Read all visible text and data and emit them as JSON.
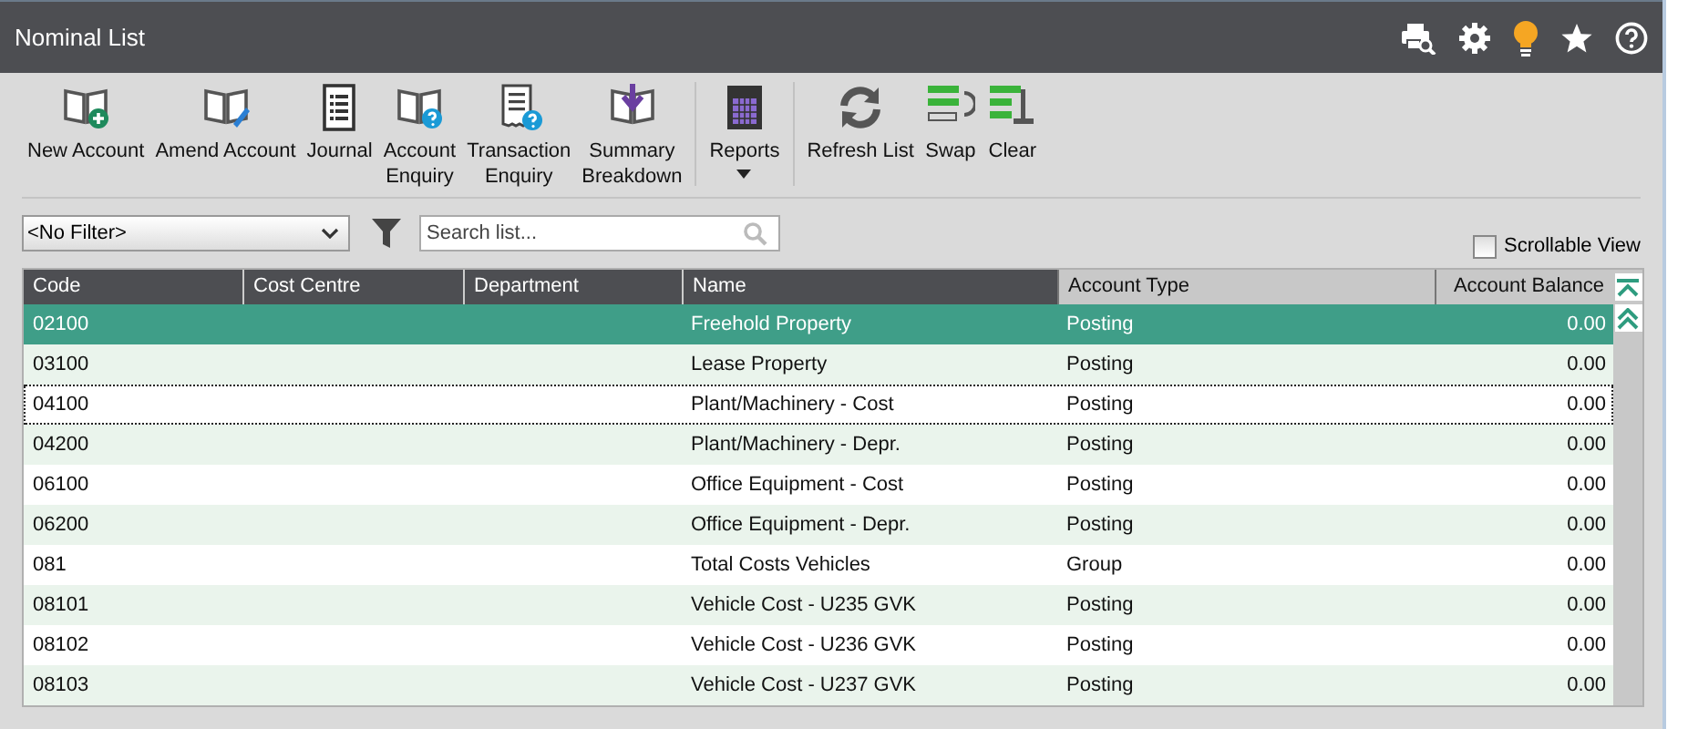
{
  "window": {
    "title": "Nominal List"
  },
  "toolbar": {
    "groups": [
      [
        {
          "label": "New Account",
          "kind": "book-plus"
        },
        {
          "label": "Amend Account",
          "kind": "book-pencil"
        },
        {
          "label": "Journal",
          "kind": "journal"
        },
        {
          "label": "Account\nEnquiry",
          "kind": "book-question"
        },
        {
          "label": "Transaction\nEnquiry",
          "kind": "receipt-question"
        },
        {
          "label": "Summary\nBreakdown",
          "kind": "book-download"
        }
      ],
      [
        {
          "label": "Reports",
          "kind": "reports",
          "dropdown": true
        }
      ],
      [
        {
          "label": "Refresh List",
          "kind": "refresh"
        },
        {
          "label": "Swap",
          "kind": "swap"
        },
        {
          "label": "Clear",
          "kind": "clear"
        }
      ]
    ]
  },
  "filter": {
    "value": "<No Filter>",
    "search_placeholder": "Search list...",
    "scrollable_view": {
      "label": "Scrollable View",
      "checked": false
    }
  },
  "table": {
    "columns": [
      {
        "label": "Code"
      },
      {
        "label": "Cost Centre"
      },
      {
        "label": "Department"
      },
      {
        "label": "Name"
      },
      {
        "label": "Account Type"
      },
      {
        "label": "Account Balance"
      }
    ],
    "rows": [
      {
        "cells": [
          "02100",
          "",
          "",
          "Freehold Property",
          "Posting",
          "0.00"
        ],
        "selected": true,
        "focused": false
      },
      {
        "cells": [
          "03100",
          "",
          "",
          "Lease Property",
          "Posting",
          "0.00"
        ],
        "selected": false,
        "focused": false
      },
      {
        "cells": [
          "04100",
          "",
          "",
          "Plant/Machinery - Cost",
          "Posting",
          "0.00"
        ],
        "selected": false,
        "focused": true
      },
      {
        "cells": [
          "04200",
          "",
          "",
          "Plant/Machinery - Depr.",
          "Posting",
          "0.00"
        ],
        "selected": false,
        "focused": false
      },
      {
        "cells": [
          "06100",
          "",
          "",
          "Office Equipment - Cost",
          "Posting",
          "0.00"
        ],
        "selected": false,
        "focused": false
      },
      {
        "cells": [
          "06200",
          "",
          "",
          "Office Equipment - Depr.",
          "Posting",
          "0.00"
        ],
        "selected": false,
        "focused": false
      },
      {
        "cells": [
          "081",
          "",
          "",
          "Total Costs Vehicles",
          "Group",
          "0.00"
        ],
        "selected": false,
        "focused": false
      },
      {
        "cells": [
          "08101",
          "",
          "",
          "Vehicle Cost - U235 GVK",
          "Posting",
          "0.00"
        ],
        "selected": false,
        "focused": false
      },
      {
        "cells": [
          "08102",
          "",
          "",
          "Vehicle Cost - U236 GVK",
          "Posting",
          "0.00"
        ],
        "selected": false,
        "focused": false
      },
      {
        "cells": [
          "08103",
          "",
          "",
          "Vehicle Cost - U237 GVK",
          "Posting",
          "0.00"
        ],
        "selected": false,
        "focused": false
      }
    ]
  }
}
